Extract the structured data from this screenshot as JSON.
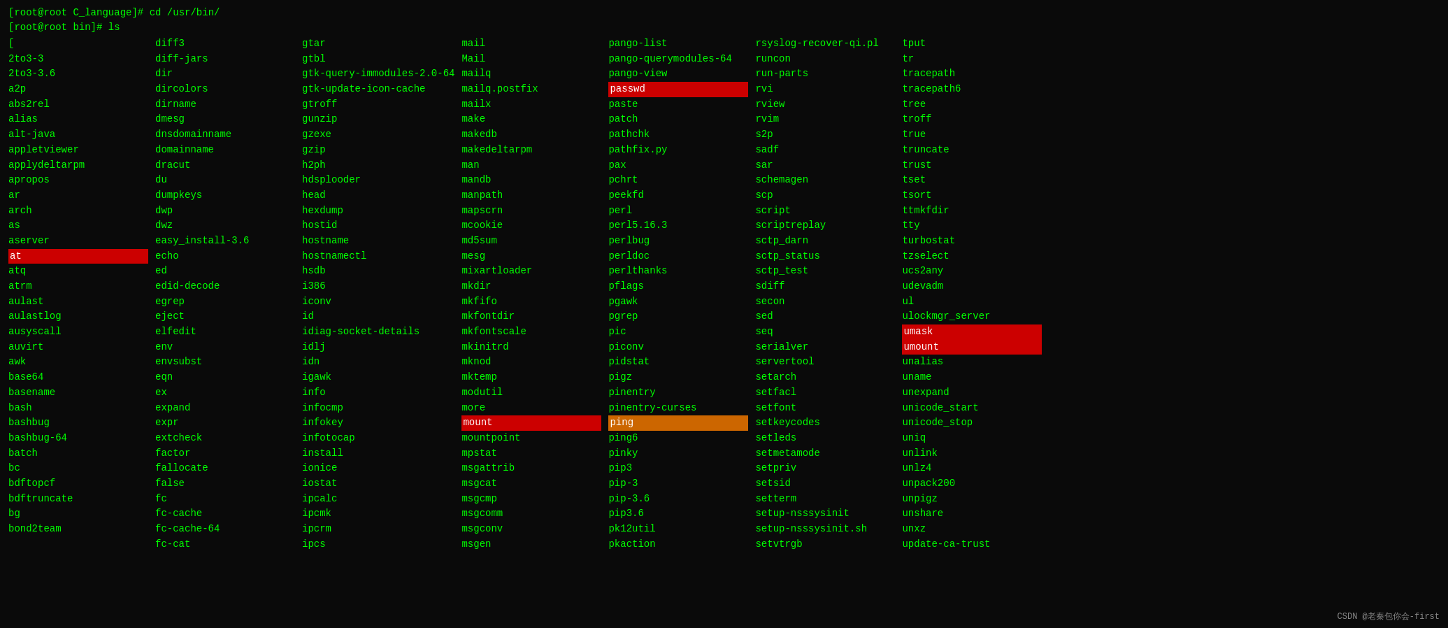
{
  "terminal": {
    "prompt1": "[root@root C_language]# cd /usr/bin/",
    "prompt2": "[root@root bin]# ls",
    "watermark": "CSDN @老秦包你会-first"
  },
  "columns": [
    {
      "items": [
        {
          "text": "[",
          "highlight": "none"
        },
        {
          "text": "2to3-3",
          "highlight": "none"
        },
        {
          "text": "2to3-3.6",
          "highlight": "none"
        },
        {
          "text": "a2p",
          "highlight": "none"
        },
        {
          "text": "abs2rel",
          "highlight": "none"
        },
        {
          "text": "alias",
          "highlight": "none"
        },
        {
          "text": "alt-java",
          "highlight": "none"
        },
        {
          "text": "appletviewer",
          "highlight": "none"
        },
        {
          "text": "applydeltarpm",
          "highlight": "none"
        },
        {
          "text": "apropos",
          "highlight": "none"
        },
        {
          "text": "ar",
          "highlight": "none"
        },
        {
          "text": "arch",
          "highlight": "none"
        },
        {
          "text": "as",
          "highlight": "none"
        },
        {
          "text": "aserver",
          "highlight": "none"
        },
        {
          "text": "at",
          "highlight": "red"
        },
        {
          "text": "atq",
          "highlight": "none"
        },
        {
          "text": "atrm",
          "highlight": "none"
        },
        {
          "text": "aulast",
          "highlight": "none"
        },
        {
          "text": "aulastlog",
          "highlight": "none"
        },
        {
          "text": "ausyscall",
          "highlight": "none"
        },
        {
          "text": "auvirt",
          "highlight": "none"
        },
        {
          "text": "awk",
          "highlight": "none"
        },
        {
          "text": "base64",
          "highlight": "none"
        },
        {
          "text": "basename",
          "highlight": "none"
        },
        {
          "text": "bash",
          "highlight": "none"
        },
        {
          "text": "bashbug",
          "highlight": "none"
        },
        {
          "text": "bashbug-64",
          "highlight": "none"
        },
        {
          "text": "batch",
          "highlight": "none"
        },
        {
          "text": "bc",
          "highlight": "none"
        },
        {
          "text": "bdftopcf",
          "highlight": "none"
        },
        {
          "text": "bdftruncate",
          "highlight": "none"
        },
        {
          "text": "bg",
          "highlight": "none"
        },
        {
          "text": "bond2team",
          "highlight": "none"
        }
      ]
    },
    {
      "items": [
        {
          "text": "diff3",
          "highlight": "none"
        },
        {
          "text": "diff-jars",
          "highlight": "none"
        },
        {
          "text": "dir",
          "highlight": "none"
        },
        {
          "text": "dircolors",
          "highlight": "none"
        },
        {
          "text": "dirname",
          "highlight": "none"
        },
        {
          "text": "dmesg",
          "highlight": "none"
        },
        {
          "text": "dnsdomainname",
          "highlight": "none"
        },
        {
          "text": "domainname",
          "highlight": "none"
        },
        {
          "text": "dracut",
          "highlight": "none"
        },
        {
          "text": "du",
          "highlight": "none"
        },
        {
          "text": "dumpkeys",
          "highlight": "none"
        },
        {
          "text": "dwp",
          "highlight": "none"
        },
        {
          "text": "dwz",
          "highlight": "none"
        },
        {
          "text": "easy_install-3.6",
          "highlight": "none"
        },
        {
          "text": "echo",
          "highlight": "none"
        },
        {
          "text": "ed",
          "highlight": "none"
        },
        {
          "text": "edid-decode",
          "highlight": "none"
        },
        {
          "text": "egrep",
          "highlight": "none"
        },
        {
          "text": "eject",
          "highlight": "none"
        },
        {
          "text": "elfedit",
          "highlight": "none"
        },
        {
          "text": "env",
          "highlight": "none"
        },
        {
          "text": "envsubst",
          "highlight": "none"
        },
        {
          "text": "eqn",
          "highlight": "none"
        },
        {
          "text": "ex",
          "highlight": "none"
        },
        {
          "text": "expand",
          "highlight": "none"
        },
        {
          "text": "expr",
          "highlight": "none"
        },
        {
          "text": "extcheck",
          "highlight": "none"
        },
        {
          "text": "factor",
          "highlight": "none"
        },
        {
          "text": "fallocate",
          "highlight": "none"
        },
        {
          "text": "false",
          "highlight": "none"
        },
        {
          "text": "fc",
          "highlight": "none"
        },
        {
          "text": "fc-cache",
          "highlight": "none"
        },
        {
          "text": "fc-cache-64",
          "highlight": "none"
        },
        {
          "text": "fc-cat",
          "highlight": "none"
        }
      ]
    },
    {
      "items": [
        {
          "text": "gtar",
          "highlight": "none"
        },
        {
          "text": "gtbl",
          "highlight": "none"
        },
        {
          "text": "gtk-query-immodules-2.0-64",
          "highlight": "none"
        },
        {
          "text": "gtk-update-icon-cache",
          "highlight": "none"
        },
        {
          "text": "gtroff",
          "highlight": "none"
        },
        {
          "text": "gunzip",
          "highlight": "none"
        },
        {
          "text": "gzexe",
          "highlight": "none"
        },
        {
          "text": "gzip",
          "highlight": "none"
        },
        {
          "text": "h2ph",
          "highlight": "none"
        },
        {
          "text": "hdsplooder",
          "highlight": "none"
        },
        {
          "text": "head",
          "highlight": "none"
        },
        {
          "text": "hexdump",
          "highlight": "none"
        },
        {
          "text": "hostid",
          "highlight": "none"
        },
        {
          "text": "hostname",
          "highlight": "none"
        },
        {
          "text": "hostnamectl",
          "highlight": "none"
        },
        {
          "text": "hsdb",
          "highlight": "none"
        },
        {
          "text": "i386",
          "highlight": "none"
        },
        {
          "text": "iconv",
          "highlight": "none"
        },
        {
          "text": "id",
          "highlight": "none"
        },
        {
          "text": "idiag-socket-details",
          "highlight": "none"
        },
        {
          "text": "idlj",
          "highlight": "none"
        },
        {
          "text": "idn",
          "highlight": "none"
        },
        {
          "text": "igawk",
          "highlight": "none"
        },
        {
          "text": "info",
          "highlight": "none"
        },
        {
          "text": "infocmp",
          "highlight": "none"
        },
        {
          "text": "infokey",
          "highlight": "none"
        },
        {
          "text": "infotocap",
          "highlight": "none"
        },
        {
          "text": "install",
          "highlight": "none"
        },
        {
          "text": "ionice",
          "highlight": "none"
        },
        {
          "text": "iostat",
          "highlight": "none"
        },
        {
          "text": "ipcalc",
          "highlight": "none"
        },
        {
          "text": "ipcmk",
          "highlight": "none"
        },
        {
          "text": "ipcrm",
          "highlight": "none"
        },
        {
          "text": "ipcs",
          "highlight": "none"
        }
      ]
    },
    {
      "items": [
        {
          "text": "mail",
          "highlight": "none"
        },
        {
          "text": "Mail",
          "highlight": "none"
        },
        {
          "text": "mailq",
          "highlight": "none"
        },
        {
          "text": "mailq.postfix",
          "highlight": "none"
        },
        {
          "text": "mailx",
          "highlight": "none"
        },
        {
          "text": "make",
          "highlight": "none"
        },
        {
          "text": "makedb",
          "highlight": "none"
        },
        {
          "text": "makedeltarpm",
          "highlight": "none"
        },
        {
          "text": "man",
          "highlight": "none"
        },
        {
          "text": "mandb",
          "highlight": "none"
        },
        {
          "text": "manpath",
          "highlight": "none"
        },
        {
          "text": "mapscrn",
          "highlight": "none"
        },
        {
          "text": "mcookie",
          "highlight": "none"
        },
        {
          "text": "md5sum",
          "highlight": "none"
        },
        {
          "text": "mesg",
          "highlight": "none"
        },
        {
          "text": "mixartloader",
          "highlight": "none"
        },
        {
          "text": "mkdir",
          "highlight": "none"
        },
        {
          "text": "mkfifo",
          "highlight": "none"
        },
        {
          "text": "mkfontdir",
          "highlight": "none"
        },
        {
          "text": "mkfontscale",
          "highlight": "none"
        },
        {
          "text": "mkinitrd",
          "highlight": "none"
        },
        {
          "text": "mknod",
          "highlight": "none"
        },
        {
          "text": "mktemp",
          "highlight": "none"
        },
        {
          "text": "modutil",
          "highlight": "none"
        },
        {
          "text": "more",
          "highlight": "none"
        },
        {
          "text": "mount",
          "highlight": "red"
        },
        {
          "text": "mountpoint",
          "highlight": "none"
        },
        {
          "text": "mpstat",
          "highlight": "none"
        },
        {
          "text": "msgattrib",
          "highlight": "none"
        },
        {
          "text": "msgcat",
          "highlight": "none"
        },
        {
          "text": "msgcmp",
          "highlight": "none"
        },
        {
          "text": "msgcomm",
          "highlight": "none"
        },
        {
          "text": "msgconv",
          "highlight": "none"
        },
        {
          "text": "msgen",
          "highlight": "none"
        }
      ]
    },
    {
      "items": [
        {
          "text": "pango-list",
          "highlight": "none"
        },
        {
          "text": "pango-querymodules-64",
          "highlight": "none"
        },
        {
          "text": "pango-view",
          "highlight": "none"
        },
        {
          "text": "passwd",
          "highlight": "red"
        },
        {
          "text": "paste",
          "highlight": "none"
        },
        {
          "text": "patch",
          "highlight": "none"
        },
        {
          "text": "pathchk",
          "highlight": "none"
        },
        {
          "text": "pathfix.py",
          "highlight": "none"
        },
        {
          "text": "pax",
          "highlight": "none"
        },
        {
          "text": "pchrt",
          "highlight": "none"
        },
        {
          "text": "peekfd",
          "highlight": "none"
        },
        {
          "text": "perl",
          "highlight": "none"
        },
        {
          "text": "perl5.16.3",
          "highlight": "none"
        },
        {
          "text": "perlbug",
          "highlight": "none"
        },
        {
          "text": "perldoc",
          "highlight": "none"
        },
        {
          "text": "perlthanks",
          "highlight": "none"
        },
        {
          "text": "pflags",
          "highlight": "none"
        },
        {
          "text": "pgawk",
          "highlight": "none"
        },
        {
          "text": "pgrep",
          "highlight": "none"
        },
        {
          "text": "pic",
          "highlight": "none"
        },
        {
          "text": "piconv",
          "highlight": "none"
        },
        {
          "text": "pidstat",
          "highlight": "none"
        },
        {
          "text": "pigz",
          "highlight": "none"
        },
        {
          "text": "pinentry",
          "highlight": "none"
        },
        {
          "text": "pinentry-curses",
          "highlight": "none"
        },
        {
          "text": "ping",
          "highlight": "orange"
        },
        {
          "text": "ping6",
          "highlight": "none"
        },
        {
          "text": "pinky",
          "highlight": "none"
        },
        {
          "text": "pip3",
          "highlight": "none"
        },
        {
          "text": "pip-3",
          "highlight": "none"
        },
        {
          "text": "pip-3.6",
          "highlight": "none"
        },
        {
          "text": "pip3.6",
          "highlight": "none"
        },
        {
          "text": "pk12util",
          "highlight": "none"
        },
        {
          "text": "pkaction",
          "highlight": "none"
        }
      ]
    },
    {
      "items": [
        {
          "text": "rsyslog-recover-qi.pl",
          "highlight": "none"
        },
        {
          "text": "runcon",
          "highlight": "none"
        },
        {
          "text": "run-parts",
          "highlight": "none"
        },
        {
          "text": "rvi",
          "highlight": "none"
        },
        {
          "text": "rview",
          "highlight": "none"
        },
        {
          "text": "rvim",
          "highlight": "none"
        },
        {
          "text": "s2p",
          "highlight": "none"
        },
        {
          "text": "sadf",
          "highlight": "none"
        },
        {
          "text": "sar",
          "highlight": "none"
        },
        {
          "text": "schemagen",
          "highlight": "none"
        },
        {
          "text": "scp",
          "highlight": "none"
        },
        {
          "text": "script",
          "highlight": "none"
        },
        {
          "text": "scriptreplay",
          "highlight": "none"
        },
        {
          "text": "sctp_darn",
          "highlight": "none"
        },
        {
          "text": "sctp_status",
          "highlight": "none"
        },
        {
          "text": "sctp_test",
          "highlight": "none"
        },
        {
          "text": "sdiff",
          "highlight": "none"
        },
        {
          "text": "secon",
          "highlight": "none"
        },
        {
          "text": "sed",
          "highlight": "none"
        },
        {
          "text": "seq",
          "highlight": "none"
        },
        {
          "text": "serialver",
          "highlight": "none"
        },
        {
          "text": "servertool",
          "highlight": "none"
        },
        {
          "text": "setarch",
          "highlight": "none"
        },
        {
          "text": "setfacl",
          "highlight": "none"
        },
        {
          "text": "setfont",
          "highlight": "none"
        },
        {
          "text": "setkeycodes",
          "highlight": "none"
        },
        {
          "text": "setleds",
          "highlight": "none"
        },
        {
          "text": "setmetamode",
          "highlight": "none"
        },
        {
          "text": "setpriv",
          "highlight": "none"
        },
        {
          "text": "setsid",
          "highlight": "none"
        },
        {
          "text": "setterm",
          "highlight": "none"
        },
        {
          "text": "setup-nsssysinit",
          "highlight": "none"
        },
        {
          "text": "setup-nsssysinit.sh",
          "highlight": "none"
        },
        {
          "text": "setvtrgb",
          "highlight": "none"
        }
      ]
    },
    {
      "items": [
        {
          "text": "tput",
          "highlight": "none"
        },
        {
          "text": "tr",
          "highlight": "none"
        },
        {
          "text": "tracepath",
          "highlight": "none"
        },
        {
          "text": "tracepath6",
          "highlight": "none"
        },
        {
          "text": "tree",
          "highlight": "none"
        },
        {
          "text": "troff",
          "highlight": "none"
        },
        {
          "text": "true",
          "highlight": "none"
        },
        {
          "text": "truncate",
          "highlight": "none"
        },
        {
          "text": "trust",
          "highlight": "none"
        },
        {
          "text": "tset",
          "highlight": "none"
        },
        {
          "text": "tsort",
          "highlight": "none"
        },
        {
          "text": "ttmkfdir",
          "highlight": "none"
        },
        {
          "text": "tty",
          "highlight": "none"
        },
        {
          "text": "turbostat",
          "highlight": "none"
        },
        {
          "text": "tzselect",
          "highlight": "none"
        },
        {
          "text": "ucs2any",
          "highlight": "none"
        },
        {
          "text": "udevadm",
          "highlight": "none"
        },
        {
          "text": "ul",
          "highlight": "none"
        },
        {
          "text": "ulockmgr_server",
          "highlight": "none"
        },
        {
          "text": "umask",
          "highlight": "red"
        },
        {
          "text": "umount",
          "highlight": "red"
        },
        {
          "text": "unalias",
          "highlight": "none"
        },
        {
          "text": "uname",
          "highlight": "none"
        },
        {
          "text": "unexpand",
          "highlight": "none"
        },
        {
          "text": "unicode_start",
          "highlight": "none"
        },
        {
          "text": "unicode_stop",
          "highlight": "none"
        },
        {
          "text": "uniq",
          "highlight": "none"
        },
        {
          "text": "unlink",
          "highlight": "none"
        },
        {
          "text": "unlz4",
          "highlight": "none"
        },
        {
          "text": "unpack200",
          "highlight": "none"
        },
        {
          "text": "unpigz",
          "highlight": "none"
        },
        {
          "text": "unshare",
          "highlight": "none"
        },
        {
          "text": "unxz",
          "highlight": "none"
        },
        {
          "text": "update-ca-trust",
          "highlight": "none"
        }
      ]
    }
  ]
}
